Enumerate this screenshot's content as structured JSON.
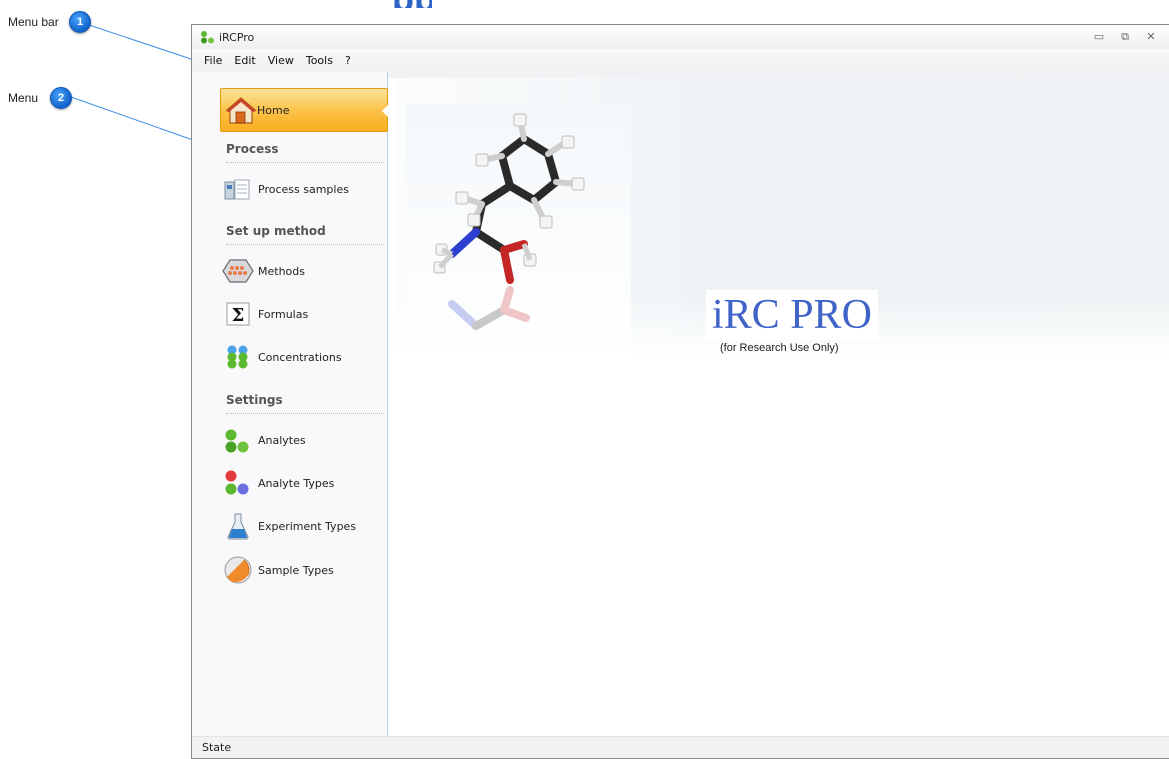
{
  "callouts": [
    {
      "label": "Menu bar",
      "number": "1"
    },
    {
      "label": "Menu",
      "number": "2"
    }
  ],
  "window": {
    "title": "iRCPro",
    "controls": [
      "minimize",
      "restore",
      "close"
    ]
  },
  "menubar": {
    "items": [
      "File",
      "Edit",
      "View",
      "Tools",
      "?"
    ]
  },
  "sidebar": {
    "home": {
      "label": "Home",
      "icon": "house-icon"
    },
    "sections": [
      {
        "title": "Process",
        "items": [
          {
            "label": "Process samples",
            "icon": "process-samples-icon"
          }
        ]
      },
      {
        "title": "Set up method",
        "items": [
          {
            "label": "Methods",
            "icon": "methods-icon"
          },
          {
            "label": "Formulas",
            "icon": "sigma-icon"
          },
          {
            "label": "Concentrations",
            "icon": "concentrations-icon"
          }
        ]
      },
      {
        "title": "Settings",
        "items": [
          {
            "label": "Analytes",
            "icon": "analytes-icon"
          },
          {
            "label": "Analyte Types",
            "icon": "analyte-types-icon"
          },
          {
            "label": "Experiment Types",
            "icon": "flask-icon"
          },
          {
            "label": "Sample Types",
            "icon": "sample-types-icon"
          }
        ]
      }
    ]
  },
  "main": {
    "product_name": "iRC PRO",
    "product_subtitle": "(for Research Use Only)"
  },
  "statusbar": {
    "text": "State"
  },
  "colors": {
    "home_active": "#f9ae1e",
    "product_name": "#3f63c7",
    "callout_badge": "#1163c9",
    "sidebar_border": "#b9d3e6"
  }
}
